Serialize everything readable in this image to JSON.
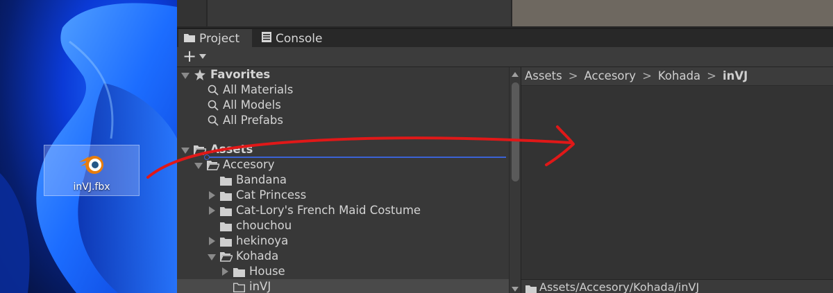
{
  "desktop": {
    "file_icon": {
      "name": "blender-file-icon",
      "label": "inVJ.fbx"
    }
  },
  "tabs": [
    {
      "label": "Project",
      "icon": "folder-icon",
      "active": true
    },
    {
      "label": "Console",
      "icon": "console-icon",
      "active": false
    }
  ],
  "toolbar": {
    "add_label": "+"
  },
  "favorites": {
    "label": "Favorites",
    "items": [
      "All Materials",
      "All Models",
      "All Prefabs"
    ]
  },
  "assets": {
    "label": "Assets",
    "tree": [
      {
        "label": "Accesory",
        "expanded": true
      },
      {
        "label": "Bandana"
      },
      {
        "label": "Cat Princess"
      },
      {
        "label": "Cat-Lory's French Maid Costume"
      },
      {
        "label": "chouchou"
      },
      {
        "label": "hekinoya"
      },
      {
        "label": "Kohada",
        "expanded": true
      },
      {
        "label": "House"
      },
      {
        "label": "inVJ",
        "selected": true
      }
    ]
  },
  "breadcrumb": [
    "Assets",
    "Accesory",
    "Kohada",
    "inVJ"
  ],
  "breadcrumb_sep": ">",
  "status_path": "Assets/Accesory/Kohada/inVJ",
  "colors": {
    "accent": "#3b63d6",
    "drag_arrow": "#e01818"
  }
}
